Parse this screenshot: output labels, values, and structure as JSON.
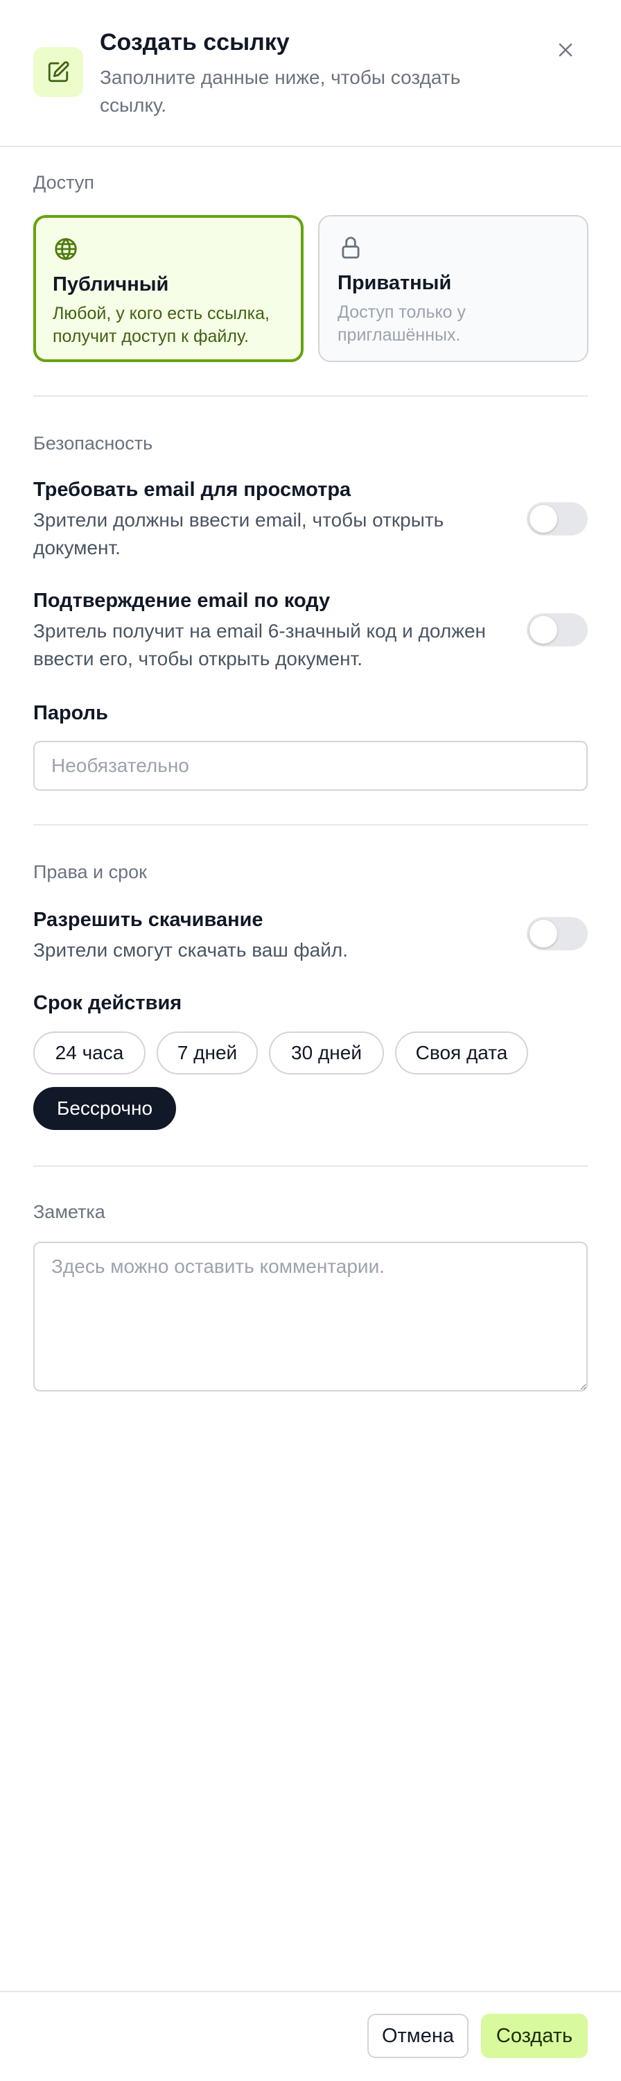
{
  "header": {
    "title": "Создать ссылку",
    "subtitle": "Заполните данные ниже, чтобы создать ссылку.",
    "icon": "edit-icon",
    "close_icon": "close-icon"
  },
  "access": {
    "label": "Доступ",
    "options": [
      {
        "title": "Публичный",
        "desc": "Любой, у кого есть ссылка, получит доступ к файлу.",
        "icon": "globe-icon",
        "selected": true
      },
      {
        "title": "Приватный",
        "desc": "Доступ только у приглашённых.",
        "icon": "lock-icon",
        "selected": false
      }
    ]
  },
  "security": {
    "label": "Безопасность",
    "require_email": {
      "title": "Требовать email для просмотра",
      "desc": "Зрители должны ввести email, чтобы открыть документ.",
      "enabled": false
    },
    "email_code": {
      "title": "Подтверждение email по коду",
      "desc": "Зритель получит на email 6-значный код и должен ввести его, чтобы открыть документ.",
      "enabled": false
    },
    "password": {
      "label": "Пароль",
      "placeholder": "Необязательно",
      "value": ""
    }
  },
  "rights": {
    "label": "Права и срок",
    "download": {
      "title": "Разрешить скачивание",
      "desc": "Зрители смогут скачать ваш файл.",
      "enabled": false
    },
    "expiry": {
      "label": "Срок действия",
      "options": [
        "24 часа",
        "7 дней",
        "30 дней",
        "Своя дата",
        "Бессрочно"
      ],
      "selected": "Бессрочно"
    }
  },
  "note": {
    "label": "Заметка",
    "placeholder": "Здесь можно оставить комментарии.",
    "value": ""
  },
  "footer": {
    "cancel": "Отмена",
    "create": "Создать"
  },
  "colors": {
    "accent": "#65a30d",
    "accent_bg": "#f7fee7",
    "create_bg": "#d9f99d",
    "selected_chip": "#111827"
  }
}
